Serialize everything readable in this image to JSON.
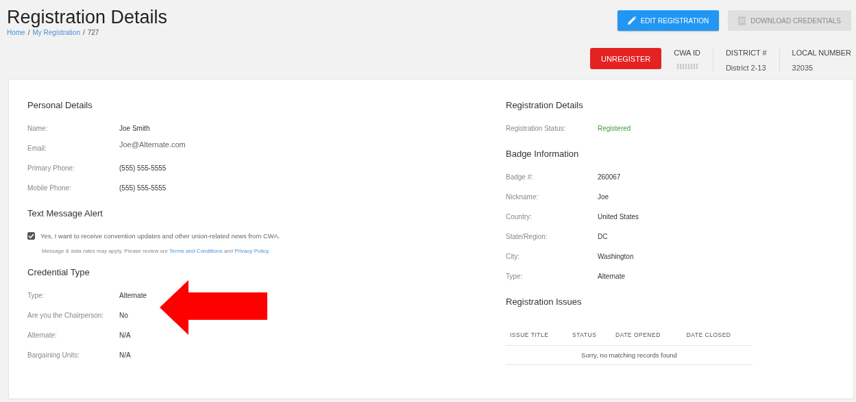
{
  "header": {
    "title": "Registration Details",
    "breadcrumb": [
      {
        "label": "Home",
        "kind": "link"
      },
      {
        "label": "/",
        "kind": "separator"
      },
      {
        "label": "My Registration",
        "kind": "link"
      },
      {
        "label": "/",
        "kind": "separator"
      },
      {
        "label": "727",
        "kind": "current"
      }
    ]
  },
  "actions": [
    {
      "label": "EDIT REGISTRATION",
      "kind": "edit",
      "disabled": false
    },
    {
      "label": "DOWNLOAD CREDENTIALS",
      "kind": "download",
      "disabled": true
    }
  ],
  "unregister_button": "UNREGISTER",
  "stats": [
    {
      "label": "CWA ID",
      "kind": "redacted"
    },
    {
      "label": "DISTRICT #",
      "value": "District 2-13",
      "kind": "text"
    },
    {
      "label": "LOCAL NUMBER",
      "value": "32035",
      "kind": "text"
    }
  ],
  "personal_details": {
    "title": "Personal Details",
    "fields": [
      {
        "label": "Name:",
        "value": "Joe Smith",
        "kind": "text"
      },
      {
        "label": "Email:",
        "value": "Joe@Alternate.com",
        "kind": "email"
      },
      {
        "label": "Primary Phone:",
        "value": "(555) 555-5555",
        "kind": "text"
      },
      {
        "label": "Mobile Phone:",
        "value": "(555) 555-5555",
        "kind": "text"
      }
    ]
  },
  "text_message_alert": {
    "title": "Text Message Alert",
    "consent": {
      "text": "Yes, I want to receive convention updates and other union-related news from CWA.",
      "checked": true
    },
    "note": [
      {
        "text": "Message & data rates may apply. Please review our ",
        "kind": "text"
      },
      {
        "text": "Terms and Conditions",
        "kind": "link"
      },
      {
        "text": " and ",
        "kind": "text"
      },
      {
        "text": "Privacy Policy",
        "kind": "link"
      },
      {
        "text": ".",
        "kind": "text"
      }
    ]
  },
  "credential_type": {
    "title": "Credential Type",
    "fields": [
      {
        "label": "Type:",
        "value": "Alternate",
        "kind": "text"
      },
      {
        "label": "Are you the Chairperson:",
        "value": "No",
        "kind": "text"
      },
      {
        "label": "Alternate:",
        "value": "N/A",
        "kind": "text"
      },
      {
        "label": "Bargaining Units:",
        "value": "N/A",
        "kind": "text"
      }
    ]
  },
  "registration_details": {
    "title": "Registration Details",
    "fields": [
      {
        "label": "Registration Status:",
        "value": "Registered",
        "kind": "status"
      }
    ]
  },
  "badge_information": {
    "title": "Badge Information",
    "fields": [
      {
        "label": "Badge #:",
        "value": "260067",
        "kind": "text"
      },
      {
        "label": "Nickname:",
        "value": "Joe",
        "kind": "text"
      },
      {
        "label": "Country:",
        "value": "United States",
        "kind": "text"
      },
      {
        "label": "State/Region:",
        "value": "DC",
        "kind": "text"
      },
      {
        "label": "City:",
        "value": "Washington",
        "kind": "text"
      },
      {
        "label": "Type:",
        "value": "Alternate",
        "kind": "text"
      }
    ]
  },
  "registration_issues": {
    "title": "Registration Issues",
    "columns": [
      "ISSUE TITLE",
      "STATUS",
      "DATE OPENED",
      "DATE CLOSED"
    ],
    "empty_message": "Sorry, no matching records found"
  },
  "annotation": {
    "kind": "arrow"
  }
}
